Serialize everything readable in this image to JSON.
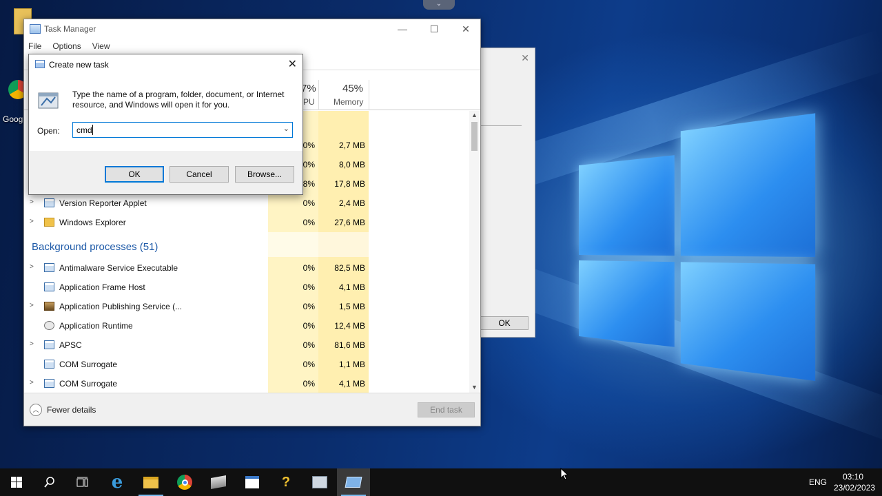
{
  "desktop": {
    "icons": [
      {
        "label": "Goog"
      }
    ]
  },
  "bg_dialog": {
    "ok_label": "OK",
    "close_glyph": "✕"
  },
  "task_manager": {
    "title": "Task Manager",
    "controls": {
      "minimize": "—",
      "maximize": "☐",
      "close": "✕"
    },
    "menu": [
      "File",
      "Options",
      "View"
    ],
    "columns": {
      "cpu_pct": "7%",
      "cpu_label": "PU",
      "mem_pct": "45%",
      "mem_label": "Memory"
    },
    "app_rows": [
      {
        "cpu": "0%",
        "mem": "2,7 MB"
      },
      {
        "cpu": "0%",
        "mem": "8,0 MB"
      },
      {
        "cpu": "8%",
        "mem": "17,8 MB"
      },
      {
        "name": "Version Reporter Applet",
        "cpu": "0%",
        "mem": "2,4 MB",
        "icon": "applet-icon",
        "expandable": true
      },
      {
        "name": "Windows Explorer",
        "cpu": "0%",
        "mem": "27,6 MB",
        "icon": "folder-icon",
        "expandable": true
      }
    ],
    "background_header": "Background processes (51)",
    "background_rows": [
      {
        "name": "Antimalware Service Executable",
        "cpu": "0%",
        "mem": "82,5 MB",
        "expandable": true,
        "icon": "process-icon"
      },
      {
        "name": "Application Frame Host",
        "cpu": "0%",
        "mem": "4,1 MB",
        "expandable": false,
        "icon": "process-icon"
      },
      {
        "name": "Application Publishing Service (...",
        "cpu": "0%",
        "mem": "1,5 MB",
        "expandable": true,
        "icon": "publishing-icon"
      },
      {
        "name": "Application Runtime",
        "cpu": "0%",
        "mem": "12,4 MB",
        "expandable": false,
        "icon": "runtime-icon"
      },
      {
        "name": "APSC",
        "cpu": "0%",
        "mem": "81,6 MB",
        "expandable": true,
        "icon": "process-icon"
      },
      {
        "name": "COM Surrogate",
        "cpu": "0%",
        "mem": "1,1 MB",
        "expandable": false,
        "icon": "process-icon"
      },
      {
        "name": "COM Surrogate",
        "cpu": "0%",
        "mem": "4,1 MB",
        "expandable": true,
        "icon": "process-icon"
      }
    ],
    "footer": {
      "fewer_details": "Fewer details",
      "end_task": "End task"
    }
  },
  "run_dialog": {
    "title": "Create new task",
    "close_glyph": "✕",
    "description": "Type the name of a program, folder, document, or Internet resource, and Windows will open it for you.",
    "open_label": "Open:",
    "open_value": "cmd",
    "buttons": {
      "ok": "OK",
      "cancel": "Cancel",
      "browse": "Browse..."
    }
  },
  "taskbar": {
    "items": [
      "start-icon",
      "search-icon",
      "task-view-icon",
      "edge-icon",
      "file-explorer-icon",
      "chrome-icon",
      "server-manager-icon",
      "notepad-icon",
      "help-icon",
      "control-panel-icon",
      "task-manager-icon"
    ],
    "language": "ENG",
    "time": "03:10",
    "date": "23/02/2023"
  }
}
